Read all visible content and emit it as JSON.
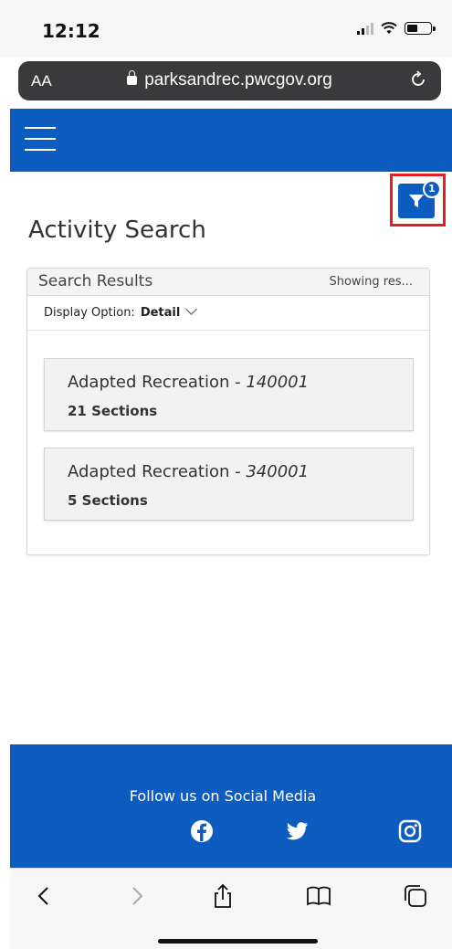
{
  "status_bar": {
    "time": "12:12"
  },
  "browser": {
    "text_size_label": "AA",
    "url": "parksandrec.pwcgov.org"
  },
  "filter": {
    "badge_count": "1"
  },
  "page": {
    "title": "Activity Search"
  },
  "results": {
    "header_title": "Search Results",
    "showing_text": "Showing res...",
    "display_option_label": "Display Option:",
    "display_option_value": "Detail",
    "items": [
      {
        "name": "Adapted Recreation - ",
        "code": "140001",
        "sections": "21 Sections"
      },
      {
        "name": "Adapted Recreation - ",
        "code": "340001",
        "sections": "5 Sections"
      }
    ]
  },
  "footer": {
    "title": "Follow us on Social Media",
    "icons": [
      "facebook-icon",
      "twitter-icon",
      "instagram-icon"
    ]
  },
  "colors": {
    "brand_blue": "#0d5cbf",
    "highlight_red": "#e02020"
  }
}
